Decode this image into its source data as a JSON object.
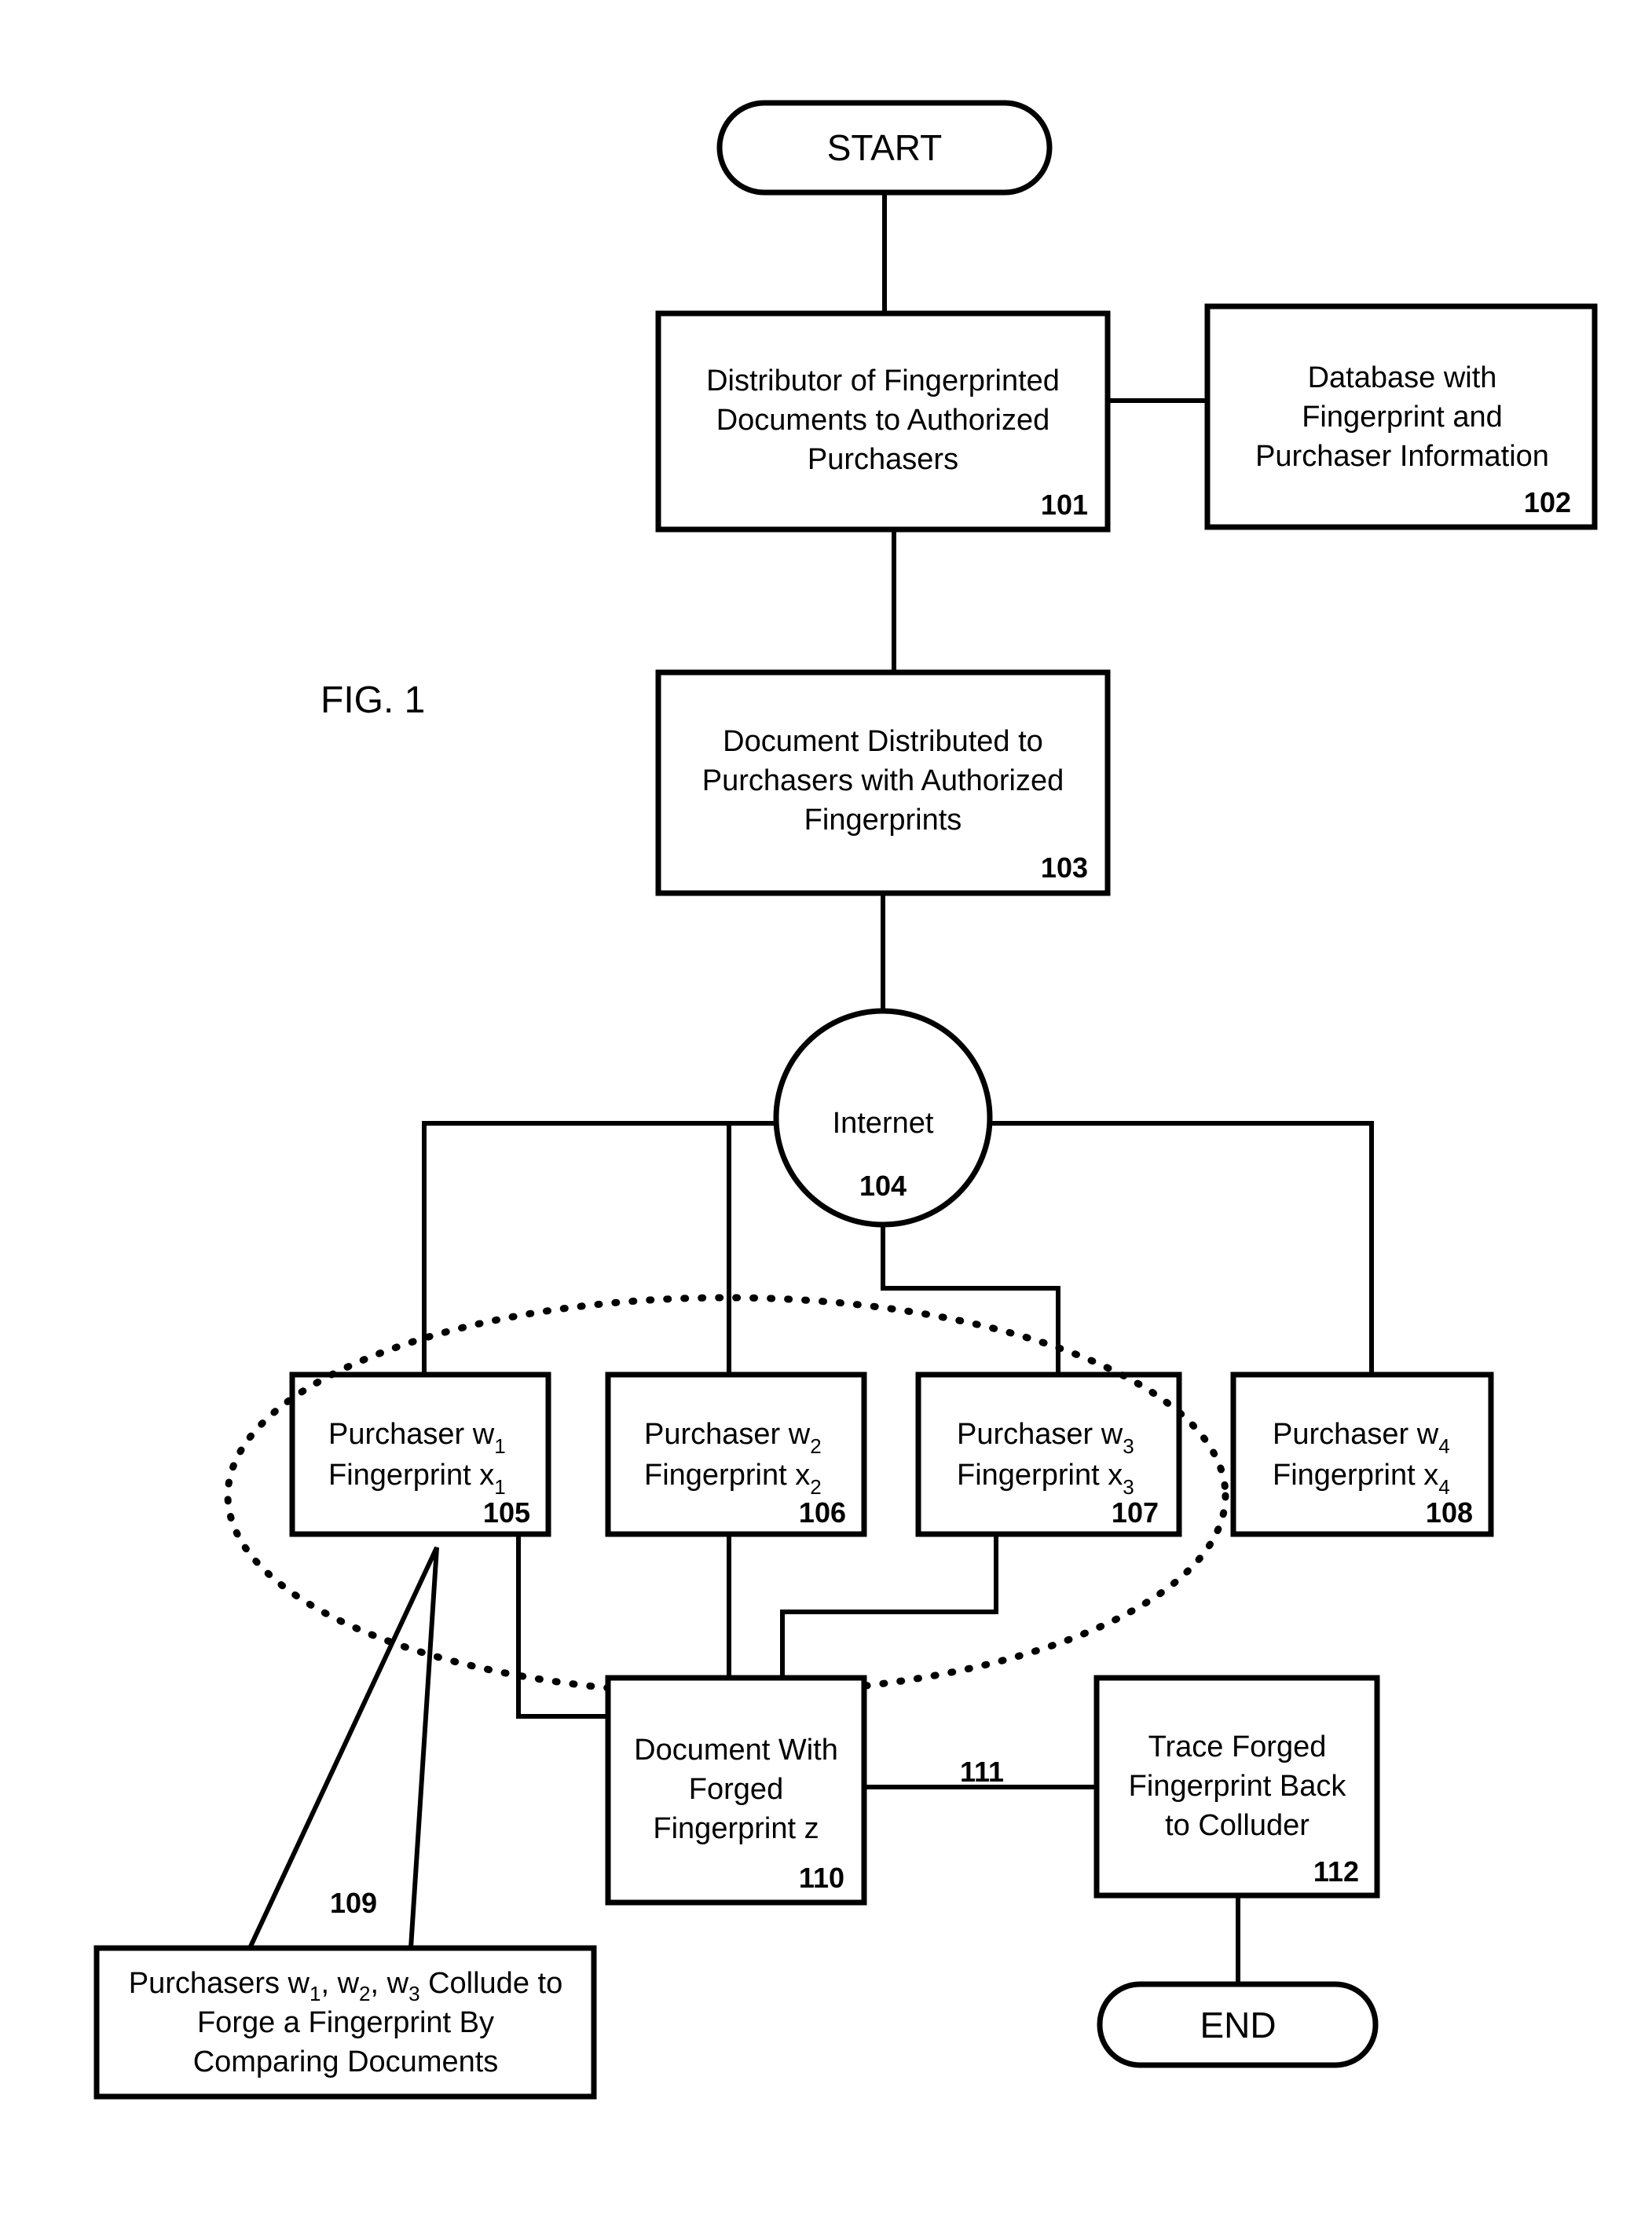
{
  "figure_label": "FIG. 1",
  "terminals": {
    "start": "START",
    "end": "END"
  },
  "nodes": {
    "n101": {
      "lines": [
        "Distributor of Fingerprinted",
        "Documents to Authorized",
        "Purchasers"
      ],
      "ref": "101"
    },
    "n102": {
      "lines": [
        "Database with",
        "Fingerprint and",
        "Purchaser Information"
      ],
      "ref": "102"
    },
    "n103": {
      "lines": [
        "Document Distributed to",
        "Purchasers with Authorized",
        "Fingerprints"
      ],
      "ref": "103"
    },
    "n104": {
      "lines": [
        "Internet"
      ],
      "ref": "104"
    },
    "n105": {
      "line1": "Purchaser w",
      "sub1": "1",
      "line2": "Fingerprint x",
      "sub2": "1",
      "ref": "105"
    },
    "n106": {
      "line1": "Purchaser w",
      "sub1": "2",
      "line2": "Fingerprint x",
      "sub2": "2",
      "ref": "106"
    },
    "n107": {
      "line1": "Purchaser w",
      "sub1": "3",
      "line2": "Fingerprint x",
      "sub2": "3",
      "ref": "107"
    },
    "n108": {
      "line1": "Purchaser w",
      "sub1": "4",
      "line2": "Fingerprint x",
      "sub2": "4",
      "ref": "108"
    },
    "n109": {
      "line1_a": "Purchasers w",
      "s1": "1",
      "line1_b": ", w",
      "s2": "2",
      "line1_c": ", w",
      "s3": "3",
      "line1_d": " Collude to",
      "line2": "Forge a Fingerprint By",
      "line3": "Comparing Documents",
      "ref": "109"
    },
    "n110": {
      "lines": [
        "Document With",
        "Forged",
        "Fingerprint z"
      ],
      "ref": "110"
    },
    "n111": {
      "ref": "111"
    },
    "n112": {
      "lines": [
        "Trace Forged",
        "Fingerprint Back",
        "to Colluder"
      ],
      "ref": "112"
    }
  }
}
